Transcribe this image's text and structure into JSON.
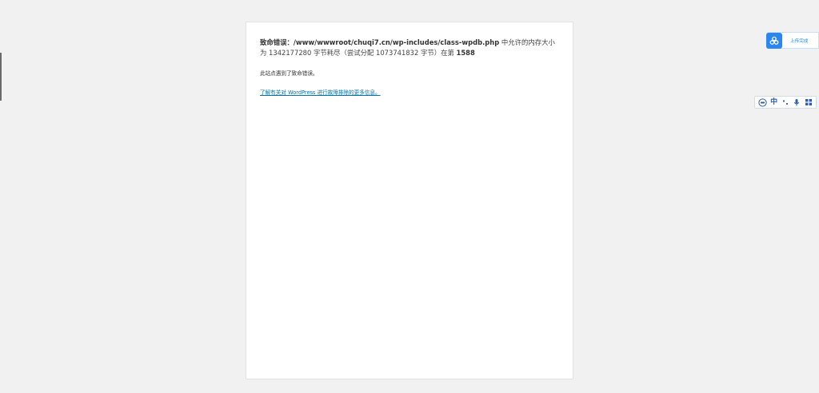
{
  "error": {
    "prefix": "致命错误：",
    "path": "/www/wwwroot/chuqi7.cn/wp-includes/class-wpdb.php",
    "text_mid": " 中允许的内存大小为 1342177280 字节耗尽（尝试分配 1073741832 字节）在第 ",
    "line_number": "1588"
  },
  "message": "此站点遇到了致命错误。",
  "help_link": "了解有关对 WordPress 进行故障排除的更多信息。",
  "upload_widget": {
    "label": "上传完成",
    "icon": "cloud-link-icon",
    "color": "#2a86f0"
  },
  "ime_toolbar": {
    "items": [
      {
        "icon": "ime-logo-icon"
      },
      {
        "label": "中"
      },
      {
        "icon": "punctuation-icon"
      },
      {
        "icon": "microphone-icon"
      },
      {
        "icon": "grid-menu-icon"
      }
    ],
    "color": "#2d5fb3"
  }
}
